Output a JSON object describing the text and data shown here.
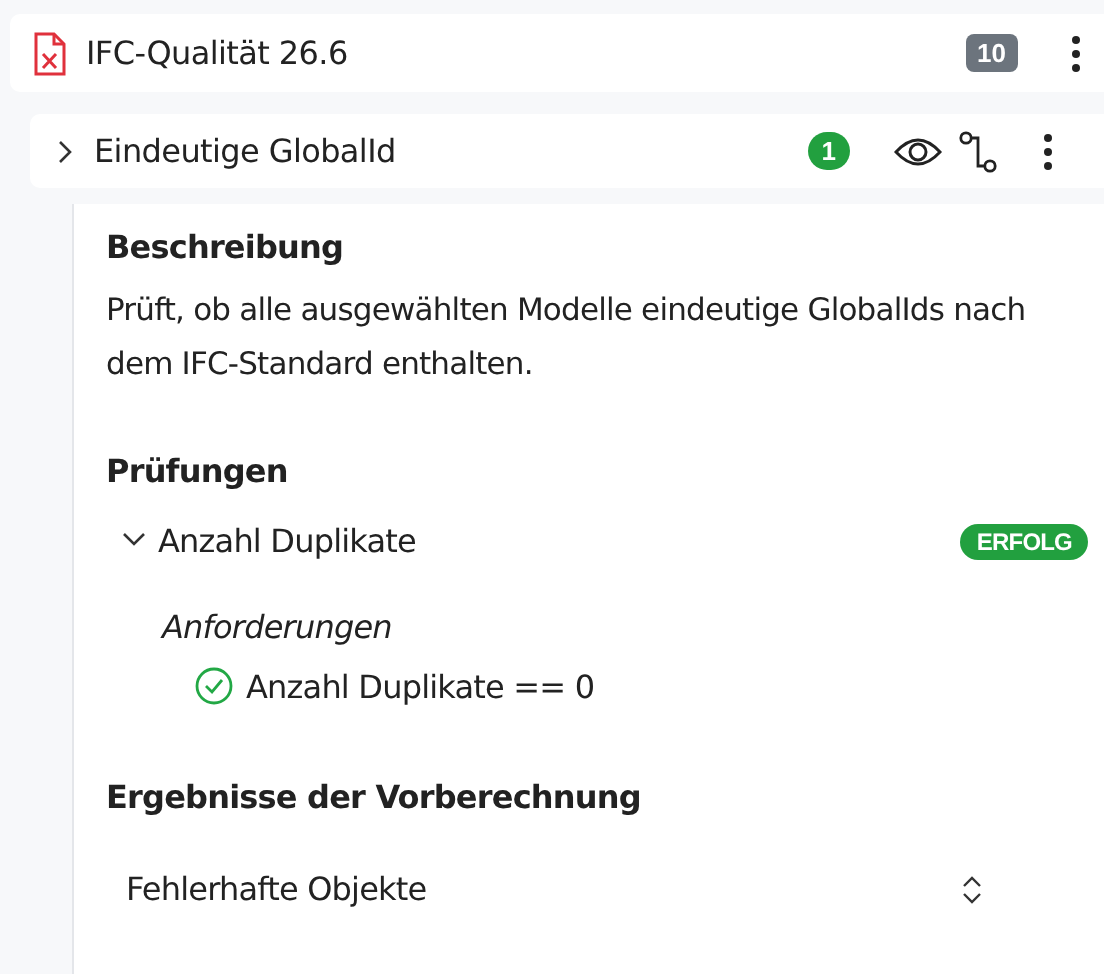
{
  "ruleset": {
    "title": "IFC-Qualität 26.6",
    "count": "10"
  },
  "rule": {
    "title": "Eindeutige GlobalId",
    "expanded": false,
    "count": "1"
  },
  "details": {
    "description_heading": "Beschreibung",
    "description": "Prüft, ob alle ausgewählten Modelle eindeutige GlobalIds nach dem IFC-Standard enthalten.",
    "checks_heading": "Prüfungen",
    "checks": [
      {
        "title": "Anzahl Duplikate",
        "expanded": true,
        "passed": true,
        "status_label": "ERFOLG",
        "requirements_heading": "Anforderungen",
        "requirements": [
          {
            "text": "Anzahl Duplikate == 0",
            "passed": true
          }
        ]
      }
    ],
    "results_heading": "Ergebnisse der Vorberechnung",
    "results_select": {
      "value": "Fehlerhafte Objekte"
    }
  }
}
